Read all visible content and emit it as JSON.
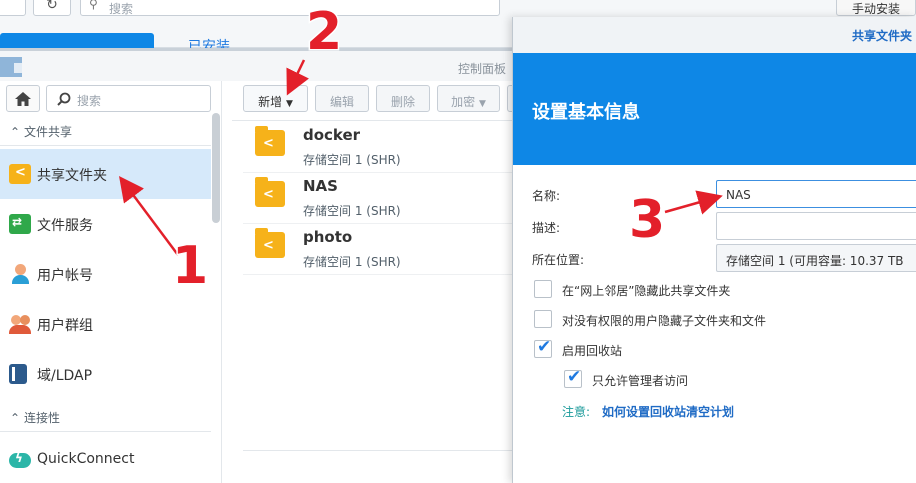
{
  "topbar": {
    "search_placeholder": "搜索",
    "right_button": "手动安装",
    "installed_label": "已安装"
  },
  "window": {
    "title": "控制面板"
  },
  "sidebar": {
    "search_placeholder": "搜索",
    "sections": [
      {
        "label": "文件共享",
        "items": [
          {
            "label": "共享文件夹",
            "active": true
          },
          {
            "label": "文件服务"
          },
          {
            "label": "用户帐号"
          },
          {
            "label": "用户群组"
          },
          {
            "label": "域/LDAP"
          }
        ]
      },
      {
        "label": "连接性",
        "items": [
          {
            "label": "QuickConnect"
          }
        ]
      }
    ]
  },
  "toolbar": {
    "new_label": "新增",
    "edit_label": "编辑",
    "delete_label": "删除",
    "encrypt_label": "加密"
  },
  "folders": [
    {
      "name": "docker",
      "volume": "存储空间 1 (SHR)"
    },
    {
      "name": "NAS",
      "volume": "存储空间 1 (SHR)"
    },
    {
      "name": "photo",
      "volume": "存储空间 1 (SHR)"
    }
  ],
  "dialog": {
    "title": "共享文件夹",
    "header": "设置基本信息",
    "name_label": "名称:",
    "name_value": "NAS",
    "desc_label": "描述:",
    "desc_value": "",
    "location_label": "所在位置:",
    "location_value": "存储空间 1 (可用容量:  10.37 TB",
    "options": [
      {
        "label": "在“网上邻居”隐藏此共享文件夹",
        "checked": false
      },
      {
        "label": "对没有权限的用户隐藏子文件夹和文件",
        "checked": false
      },
      {
        "label": "启用回收站",
        "checked": true
      },
      {
        "label": "只允许管理者访问",
        "checked": true
      }
    ],
    "note_label": "注意:",
    "note_link": "如何设置回收站清空计划"
  },
  "annotations": [
    "1",
    "2",
    "3"
  ],
  "colors": {
    "accent": "#0e87e6",
    "annotation": "#e3202a",
    "folder": "#f6b21a",
    "active_bg": "#d6e9fa"
  }
}
